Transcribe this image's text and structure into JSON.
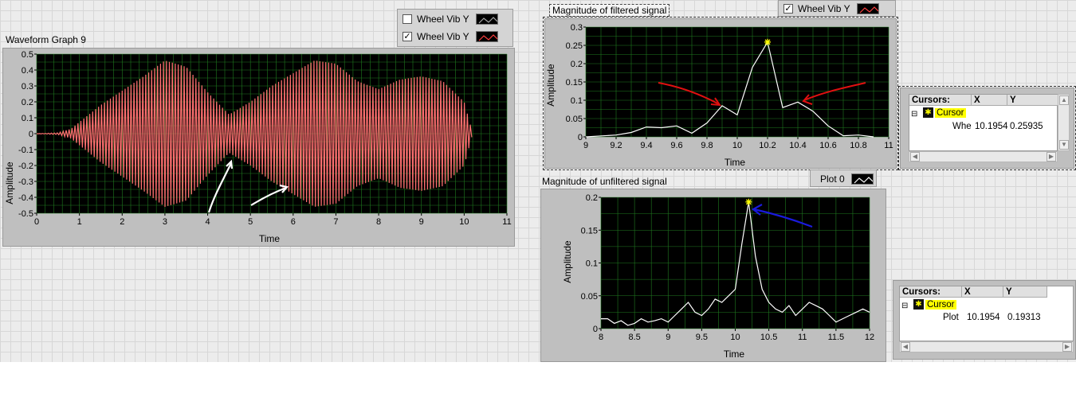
{
  "graph1": {
    "title": "Waveform Graph 9",
    "xlabel": "Time",
    "ylabel": "Amplitude",
    "x_ticks": [
      "0",
      "1",
      "2",
      "3",
      "4",
      "5",
      "6",
      "7",
      "8",
      "9",
      "10",
      "11"
    ],
    "y_ticks": [
      "0.5",
      "0.4",
      "0.3",
      "0.2",
      "0.1",
      "0",
      "-0.1",
      "-0.2",
      "-0.3",
      "-0.4",
      "-0.5"
    ],
    "legend": [
      {
        "label": "Wheel Vib Y",
        "checked": false,
        "check_mark": ""
      },
      {
        "label": "Wheel Vib Y",
        "checked": true,
        "check_mark": "✓"
      }
    ]
  },
  "graph2": {
    "title": "Magnitude of filtered signal",
    "xlabel": "Time",
    "ylabel": "Amplitude",
    "x_ticks": [
      "9",
      "9.2",
      "9.4",
      "9.6",
      "9.8",
      "10",
      "10.2",
      "10.4",
      "10.6",
      "10.8",
      "11"
    ],
    "y_ticks": [
      "0.3",
      "0.25",
      "0.2",
      "0.15",
      "0.1",
      "0.05",
      "0"
    ],
    "legend": {
      "label": "Wheel Vib Y",
      "check_mark": "✓"
    },
    "cursors": {
      "header": "Cursors:",
      "col_x": "X",
      "col_y": "Y",
      "cursor_name": "Cursor",
      "plot_name": "Whe",
      "x": "10.1954",
      "y": "0.25935"
    }
  },
  "graph3": {
    "title": "Magnitude of unfiltered signal",
    "xlabel": "Time",
    "ylabel": "Amplitude",
    "x_ticks": [
      "8",
      "8.5",
      "9",
      "9.5",
      "10",
      "10.5",
      "11",
      "11.5",
      "12"
    ],
    "y_ticks": [
      "0.2",
      "0.15",
      "0.1",
      "0.05",
      "0"
    ],
    "legend": {
      "label": "Plot 0"
    },
    "cursors": {
      "header": "Cursors:",
      "col_x": "X",
      "col_y": "Y",
      "cursor_name": "Cursor",
      "plot_name": "Plot",
      "x": "10.1954",
      "y": "0.19313"
    }
  },
  "colors": {
    "plot_bg": "#000000",
    "grid": "#1f7a1f",
    "waveform": "#ff7070",
    "trace": "#ffffff",
    "cursor_marker": "#ffff00",
    "annot_red": "#e01010",
    "annot_blue": "#1a1adc",
    "annot_white": "#ffffff"
  },
  "chart_data": [
    {
      "type": "line",
      "title": "Waveform Graph 9",
      "xlabel": "Time",
      "ylabel": "Amplitude",
      "xlim": [
        0,
        11
      ],
      "ylim": [
        -0.5,
        0.5
      ],
      "grid": true,
      "series": [
        {
          "name": "Wheel Vib Y",
          "envelope_x": [
            0,
            0.5,
            0.8,
            1.5,
            2.5,
            3.0,
            3.5,
            4.0,
            4.5,
            5.0,
            5.5,
            6.0,
            6.5,
            7.0,
            7.5,
            8.0,
            8.5,
            9.0,
            9.5,
            10.0,
            10.2
          ],
          "envelope_y": [
            0,
            0.005,
            0.03,
            0.18,
            0.36,
            0.46,
            0.42,
            0.26,
            0.12,
            0.2,
            0.3,
            0.38,
            0.46,
            0.44,
            0.33,
            0.28,
            0.34,
            0.36,
            0.33,
            0.2,
            0.0
          ]
        }
      ]
    },
    {
      "type": "line",
      "title": "Magnitude of filtered signal",
      "xlabel": "Time",
      "ylabel": "Amplitude",
      "xlim": [
        9,
        11
      ],
      "ylim": [
        0,
        0.3
      ],
      "grid": true,
      "series": [
        {
          "name": "Wheel Vib Y",
          "x": [
            9.0,
            9.2,
            9.3,
            9.4,
            9.5,
            9.6,
            9.7,
            9.8,
            9.9,
            10.0,
            10.1,
            10.2,
            10.3,
            10.4,
            10.5,
            10.6,
            10.7,
            10.8,
            10.9
          ],
          "y": [
            0.0,
            0.005,
            0.012,
            0.027,
            0.025,
            0.03,
            0.01,
            0.038,
            0.085,
            0.06,
            0.19,
            0.259,
            0.08,
            0.095,
            0.07,
            0.03,
            0.003,
            0.005,
            0.0
          ]
        }
      ]
    },
    {
      "type": "line",
      "title": "Magnitude of unfiltered signal",
      "xlabel": "Time",
      "ylabel": "Amplitude",
      "xlim": [
        8,
        12
      ],
      "ylim": [
        0,
        0.2
      ],
      "grid": true,
      "series": [
        {
          "name": "Plot 0",
          "x": [
            8.0,
            8.1,
            8.2,
            8.3,
            8.4,
            8.5,
            8.6,
            8.7,
            8.8,
            8.9,
            9.0,
            9.1,
            9.2,
            9.3,
            9.4,
            9.5,
            9.6,
            9.7,
            9.8,
            9.9,
            10.0,
            10.1,
            10.2,
            10.3,
            10.4,
            10.5,
            10.6,
            10.7,
            10.8,
            10.9,
            11.0,
            11.1,
            11.2,
            11.3,
            11.4,
            11.5,
            11.6,
            11.7,
            11.8,
            11.9,
            12.0
          ],
          "y": [
            0.015,
            0.015,
            0.008,
            0.012,
            0.005,
            0.008,
            0.015,
            0.01,
            0.012,
            0.015,
            0.01,
            0.02,
            0.03,
            0.04,
            0.025,
            0.02,
            0.03,
            0.045,
            0.04,
            0.05,
            0.06,
            0.13,
            0.193,
            0.11,
            0.06,
            0.04,
            0.03,
            0.025,
            0.035,
            0.02,
            0.03,
            0.04,
            0.035,
            0.03,
            0.02,
            0.01,
            0.015,
            0.02,
            0.025,
            0.03,
            0.025
          ]
        }
      ]
    }
  ]
}
